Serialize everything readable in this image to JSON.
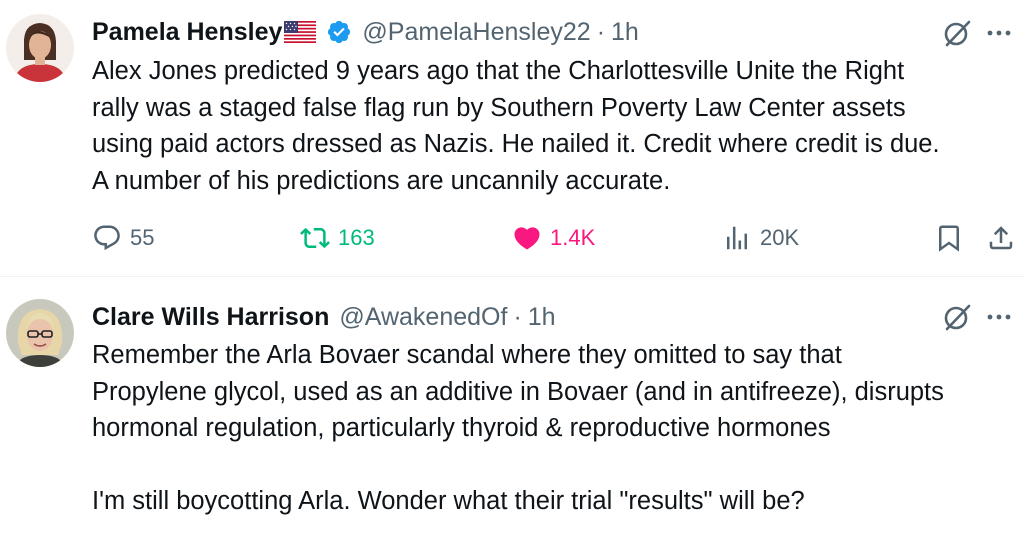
{
  "tweets": [
    {
      "author_name": "Pamela Hensley",
      "handle": "@PamelaHensley22",
      "separator": "·",
      "time": "1h",
      "lines": [
        "Alex Jones predicted 9 years ago that the Charlottesville Unite the Right",
        "rally was a staged false flag run by Southern Poverty Law Center assets",
        "using paid actors dressed as Nazis. He nailed it. Credit where credit is due.",
        "A number of his predictions are uncannily accurate."
      ],
      "stats": {
        "replies": "55",
        "reposts": "163",
        "likes": "1.4K",
        "views": "20K"
      }
    },
    {
      "author_name": "Clare Wills Harrison",
      "handle": "@AwakenedOf",
      "separator": "·",
      "time": "1h",
      "lines": [
        "Remember the Arla Bovaer scandal where they omitted to say that",
        "Propylene glycol, used as an additive in Bovaer (and in antifreeze), disrupts",
        "hormonal regulation, particularly thyroid & reproductive hormones",
        "I'm still boycotting Arla. Wonder what their trial \"results\" will be?"
      ]
    }
  ],
  "colors": {
    "text": "#0f1419",
    "secondary": "#536471",
    "repost_green": "#00ba7c",
    "like_pink": "#f91880",
    "verified_blue": "#1d9bf0"
  },
  "icons": [
    "verified-badge-icon",
    "us-flag-icon",
    "grok-icon",
    "more-icon",
    "reply-icon",
    "repost-icon",
    "heart-icon",
    "views-icon",
    "bookmark-icon",
    "share-icon"
  ]
}
